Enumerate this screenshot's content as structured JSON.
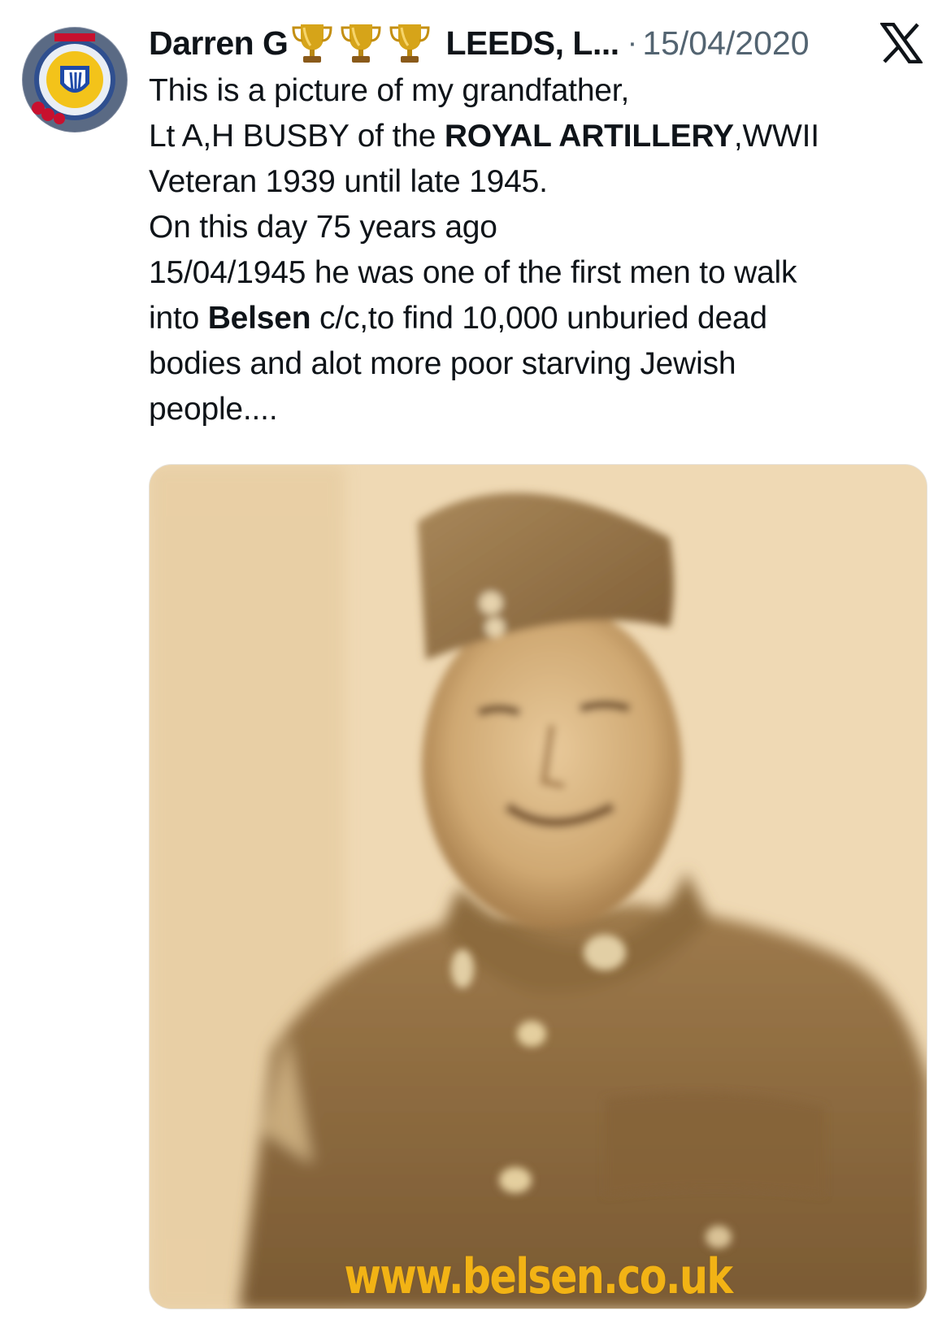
{
  "author": {
    "display_name": "Darren G",
    "name_suffix": "LEEDS, L...",
    "badge_icons": [
      "trophy-icon",
      "trophy-icon",
      "trophy-icon"
    ]
  },
  "meta": {
    "separator": "·",
    "date": "15/04/2020"
  },
  "platform_logo": "x-logo-icon",
  "tweet": {
    "lines": [
      {
        "segments": [
          {
            "text": "This is a picture of my grandfather,",
            "bold": false
          }
        ]
      },
      {
        "segments": [
          {
            "text": "Lt A,H BUSBY of the ",
            "bold": false
          },
          {
            "text": "ROYAL ARTILLERY",
            "bold": true
          },
          {
            "text": ",WWII",
            "bold": false
          }
        ]
      },
      {
        "segments": [
          {
            "text": "Veteran 1939 until late 1945.",
            "bold": false
          }
        ]
      },
      {
        "segments": [
          {
            "text": "On this day 75 years ago",
            "bold": false
          }
        ]
      },
      {
        "segments": [
          {
            "text": "15/04/1945 he was one of the first men to walk",
            "bold": false
          }
        ]
      },
      {
        "segments": [
          {
            "text": "into ",
            "bold": false
          },
          {
            "text": "Belsen",
            "bold": true
          },
          {
            "text": " c/c,to find 10,000 unburied dead",
            "bold": false
          }
        ]
      },
      {
        "segments": [
          {
            "text": "bodies and alot more poor starving Jewish",
            "bold": false
          }
        ]
      },
      {
        "segments": [
          {
            "text": "people....",
            "bold": false
          }
        ]
      }
    ]
  },
  "media": {
    "watermark": "www.belsen.co.uk"
  },
  "colors": {
    "text_primary": "#0f1419",
    "text_secondary": "#536471",
    "watermark": "#f2b315"
  }
}
